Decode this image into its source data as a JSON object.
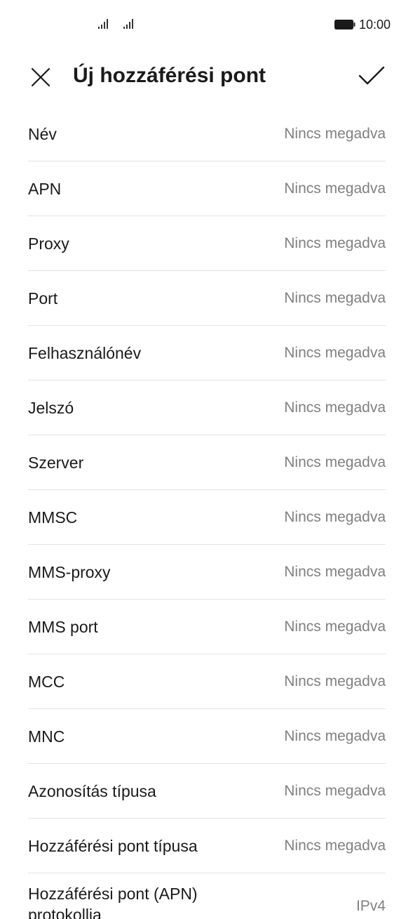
{
  "status_bar": {
    "time": "10:00",
    "icons": [
      "signal-icon",
      "signal-icon",
      "battery-icon"
    ]
  },
  "header": {
    "title": "Új hozzáférési pont",
    "close_icon": "close-icon",
    "confirm_icon": "check-icon"
  },
  "fields": [
    {
      "label": "Név",
      "value": "Nincs megadva"
    },
    {
      "label": "APN",
      "value": "Nincs megadva"
    },
    {
      "label": "Proxy",
      "value": "Nincs megadva"
    },
    {
      "label": "Port",
      "value": "Nincs megadva"
    },
    {
      "label": "Felhasználónév",
      "value": "Nincs megadva"
    },
    {
      "label": "Jelszó",
      "value": "Nincs megadva"
    },
    {
      "label": "Szerver",
      "value": "Nincs megadva"
    },
    {
      "label": "MMSC",
      "value": "Nincs megadva"
    },
    {
      "label": "MMS-proxy",
      "value": "Nincs megadva"
    },
    {
      "label": "MMS port",
      "value": "Nincs megadva"
    },
    {
      "label": "MCC",
      "value": "Nincs megadva"
    },
    {
      "label": "MNC",
      "value": "Nincs megadva"
    },
    {
      "label": "Azonosítás típusa",
      "value": "Nincs megadva"
    },
    {
      "label": "Hozzáférési pont típusa",
      "value": "Nincs megadva"
    },
    {
      "label": "Hozzáférési pont (APN) protokollja",
      "value": "IPv4"
    }
  ]
}
